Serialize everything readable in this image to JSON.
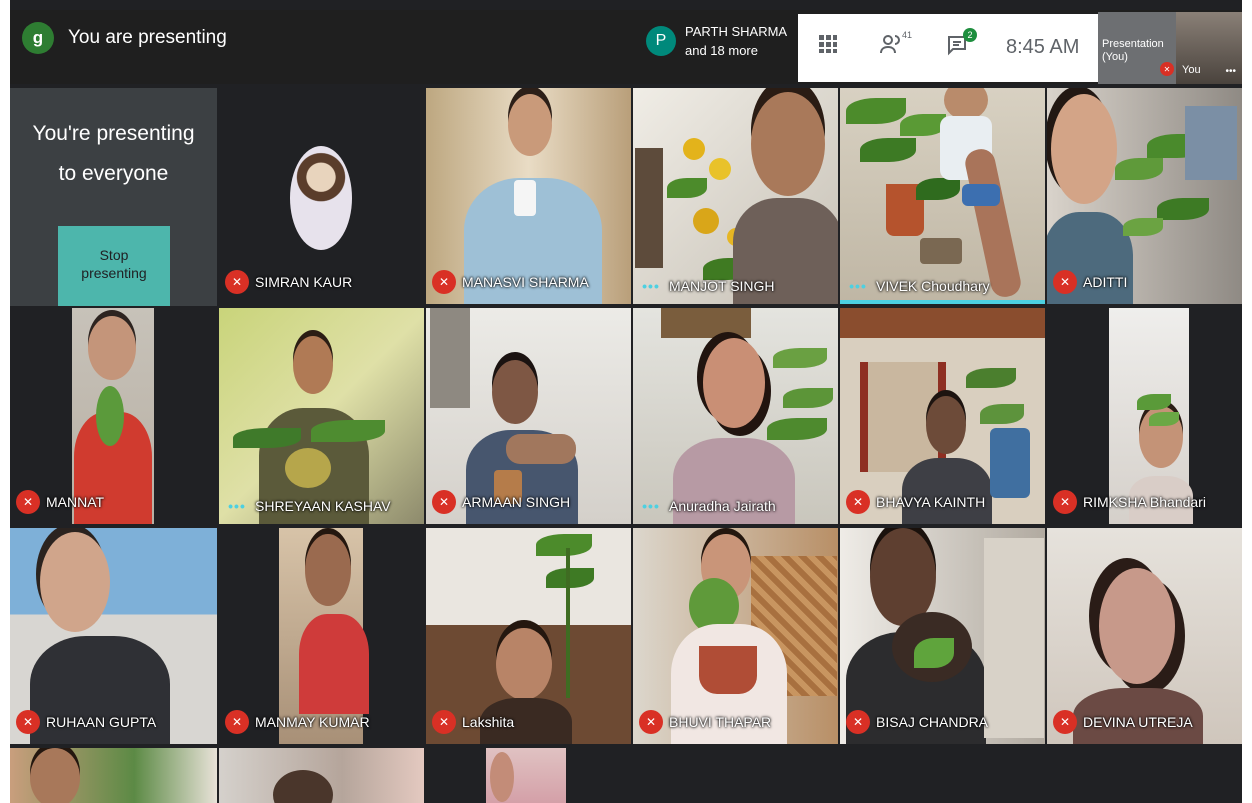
{
  "topbar": {
    "presenter_avatar_letter": "g",
    "presenting_label": "You are presenting",
    "presentation_owner_letter": "P",
    "presentation_owner_line1": "PARTH SHARMA",
    "presentation_owner_line2": "and 18 more",
    "people_count": "41",
    "chat_badge": "2",
    "time": "8:45  AM",
    "self_presentation_line1": "Presentation",
    "self_presentation_line2": "(You)",
    "self_label": "You"
  },
  "panel": {
    "line1": "You're presenting",
    "line2": "to everyone",
    "stop_line1": "Stop",
    "stop_line2": "presenting"
  },
  "participants": [
    {
      "name": "SIMRAN KAUR",
      "indicator": "muted"
    },
    {
      "name": "MANASVI SHARMA",
      "indicator": "muted"
    },
    {
      "name": "MANJOT SINGH",
      "indicator": "audio-dots"
    },
    {
      "name": "VIVEK Choudhary",
      "indicator": "audio-dots",
      "speaking": true
    },
    {
      "name": "ADITTI",
      "indicator": "muted"
    },
    {
      "name": "MANNAT",
      "indicator": "muted"
    },
    {
      "name": "SHREYAAN KASHAV",
      "indicator": "audio-dots"
    },
    {
      "name": "ARMAAN SINGH",
      "indicator": "muted"
    },
    {
      "name": "Anuradha Jairath",
      "indicator": "audio-dots"
    },
    {
      "name": "BHAVYA KAINTH",
      "indicator": "muted"
    },
    {
      "name": "RIMKSHA Bhandari",
      "indicator": "muted"
    },
    {
      "name": "RUHAAN GUPTA",
      "indicator": "muted"
    },
    {
      "name": "MANMAY KUMAR",
      "indicator": "muted"
    },
    {
      "name": "Lakshita",
      "indicator": "muted"
    },
    {
      "name": "BHUVI THAPAR",
      "indicator": "muted"
    },
    {
      "name": "BISAJ CHANDRA",
      "indicator": "muted"
    },
    {
      "name": "DEVINA UTREJA",
      "indicator": "muted"
    }
  ],
  "icons": {
    "grid": "grid-icon",
    "people": "people-icon",
    "chat": "chat-icon",
    "mic_off": "mic-off-icon",
    "more": "more-dots-icon"
  },
  "colors": {
    "muted_red": "#d93025",
    "speaking_teal": "#4dd0e1",
    "stop_button": "#4db6ac"
  }
}
